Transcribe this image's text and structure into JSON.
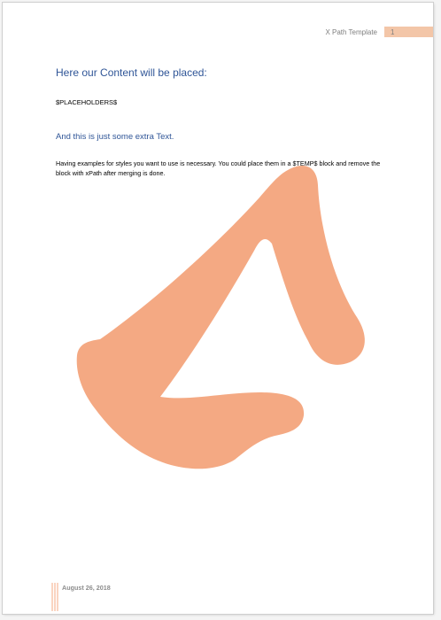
{
  "header": {
    "title": "X Path Template",
    "page_number": "1",
    "accent_color": "#f3c6a8"
  },
  "content": {
    "heading": "Here our Content will be placed:",
    "placeholder": "$PLACEHOLDERS$",
    "subheading": "And this is just some extra Text.",
    "paragraph": "Having examples for styles you want to use is necessary. You could place them in a $TEMP$ block and remove the block with xPath after merging is done."
  },
  "watermark": {
    "icon": "triangle-brush-logo",
    "color": "#f4a983"
  },
  "footer": {
    "date": "August 26, 2018",
    "line_color": "#f4a983"
  },
  "colors": {
    "heading": "#2f5597",
    "muted_text": "#7f7f7f"
  }
}
